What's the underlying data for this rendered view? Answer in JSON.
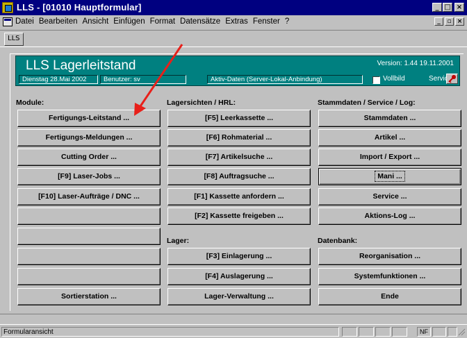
{
  "window": {
    "title": "LLS - [01010 Hauptformular]",
    "min": "_",
    "max": "□",
    "close": "×"
  },
  "menubar": {
    "items": [
      "Datei",
      "Bearbeiten",
      "Ansicht",
      "Einfügen",
      "Format",
      "Datensätze",
      "Extras",
      "Fenster",
      "?"
    ],
    "mdi": [
      "_",
      "▫",
      "×"
    ]
  },
  "toolbar": {
    "tab": "LLS"
  },
  "header": {
    "title": "LLS Lagerleitstand",
    "version": "Version: 1.44  19.11.2001",
    "date": "Dienstag 28.Mai 2002",
    "user": "Benutzer:  sv",
    "data_source": "Aktiv-Daten (Server-Lokal-Anbindung)",
    "vollbild": "Vollbild",
    "service": "Service"
  },
  "sections": {
    "module": "Module:",
    "lagersichten": "Lagersichten / HRL:",
    "stammdaten": "Stammdaten / Service / Log:",
    "lager": "Lager:",
    "datenbank": "Datenbank:"
  },
  "buttons": {
    "col1": [
      "Fertigungs-Leitstand ...",
      "Fertigungs-Meldungen ...",
      "Cutting Order ...",
      "[F9] Laser-Jobs ...",
      "[F10] Laser-Aufträge / DNC ...",
      "",
      "",
      "",
      "",
      "Sortierstation ..."
    ],
    "col2a": [
      "[F5] Leerkassette ...",
      "[F6] Rohmaterial ...",
      "[F7] Artikelsuche ...",
      "[F8] Auftragsuche ...",
      "[F1] Kassette anfordern ...",
      "[F2] Kassette freigeben ..."
    ],
    "col2b": [
      "[F3] Einlagerung ...",
      "[F4] Auslagerung ...",
      "Lager-Verwaltung ..."
    ],
    "col3a": [
      "Stammdaten ...",
      "Artikel ...",
      "Import / Export ...",
      "Mani ...",
      "Service ...",
      "Aktions-Log ..."
    ],
    "col3b": [
      "Reorganisation ...",
      "Systemfunktionen ...",
      "Ende"
    ]
  },
  "status": {
    "text": "Formularansicht",
    "nf": "NF"
  },
  "colors": {
    "titlebar": "#000080",
    "header": "#008080",
    "arrow": "#e8201a"
  }
}
